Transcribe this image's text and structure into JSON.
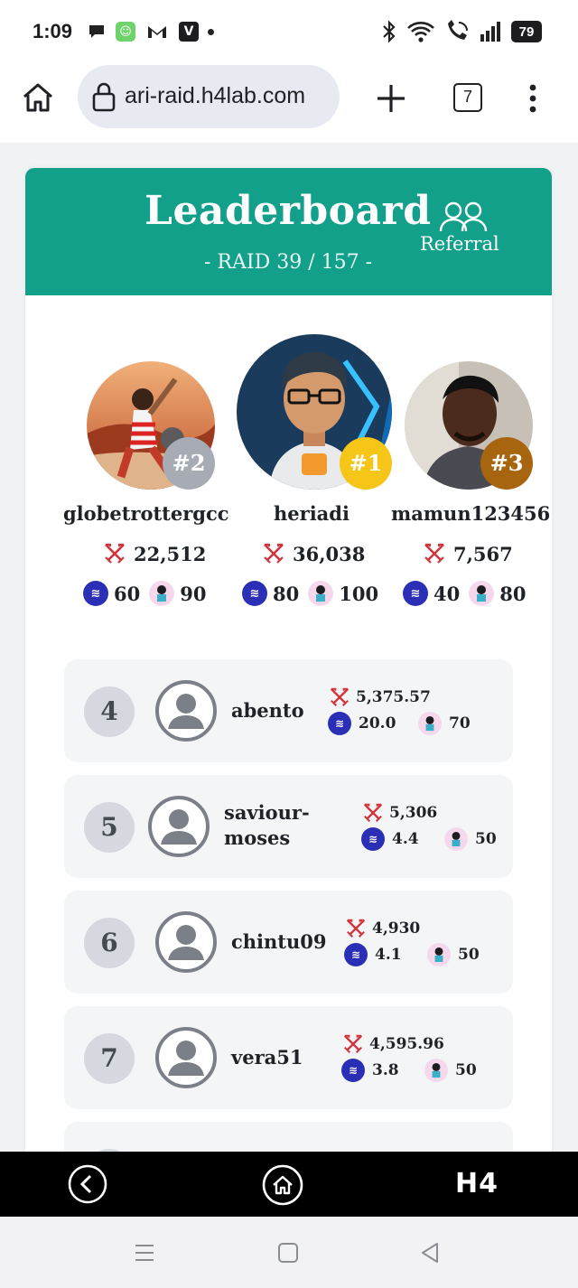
{
  "status_bar": {
    "time": "1:09",
    "battery": "79",
    "left_icons": [
      "chat-icon",
      "app-icon",
      "gmail-icon",
      "v-app-icon",
      "notification-dot-icon"
    ],
    "right_icons": [
      "bluetooth-icon",
      "wifi-icon",
      "wifi-call-icon",
      "signal-icon",
      "battery-icon"
    ]
  },
  "browser": {
    "url": "ari-raid.h4lab.com",
    "tab_count": "7"
  },
  "leaderboard": {
    "title": "Leaderboard",
    "subtitle": "- RAID 39 / 157 -",
    "referral_label": "Referral",
    "accent_color": "#12a08a"
  },
  "podium": [
    {
      "rank": "#2",
      "name": "globetrottergcc",
      "damage": "22,512",
      "steem": "60",
      "cards": "90",
      "badge_color": "#a7acb4"
    },
    {
      "rank": "#1",
      "name": "heriadi",
      "damage": "36,038",
      "steem": "80",
      "cards": "100",
      "badge_color": "#f5c518"
    },
    {
      "rank": "#3",
      "name": "mamun123456",
      "damage": "7,567",
      "steem": "40",
      "cards": "80",
      "badge_color": "#a8650f"
    }
  ],
  "rows": [
    {
      "rank": "4",
      "name_line1": "abento",
      "name_line2": "",
      "damage": "5,375.57",
      "steem": "20.0",
      "cards": "70"
    },
    {
      "rank": "5",
      "name_line1": "saviour-",
      "name_line2": "moses",
      "damage": "5,306",
      "steem": "4.4",
      "cards": "50"
    },
    {
      "rank": "6",
      "name_line1": "chintu09",
      "name_line2": "",
      "damage": "4,930",
      "steem": "4.1",
      "cards": "50"
    },
    {
      "rank": "7",
      "name_line1": "vera51",
      "name_line2": "",
      "damage": "4,595.96",
      "steem": "3.8",
      "cards": "50"
    }
  ],
  "app_bar": {
    "logo": "H4"
  }
}
